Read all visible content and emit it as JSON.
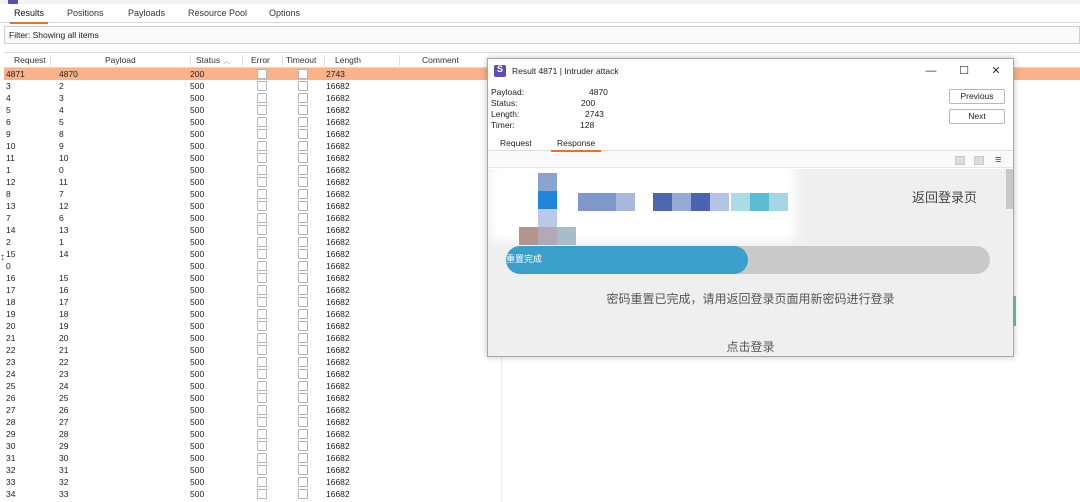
{
  "tabs": [
    {
      "label": "Results",
      "active": true
    },
    {
      "label": "Positions",
      "active": false
    },
    {
      "label": "Payloads",
      "active": false
    },
    {
      "label": "Resource Pool",
      "active": false
    },
    {
      "label": "Options",
      "active": false
    }
  ],
  "filter": {
    "text": "Filter: Showing all items"
  },
  "table": {
    "columns": [
      "Request",
      "Payload",
      "Status",
      "Error",
      "Timeout",
      "Length",
      "Comment"
    ],
    "sorted_column": "Status",
    "rows": [
      {
        "request": "4871",
        "payload": "4870",
        "status": "200",
        "length": "2743",
        "selected": true
      },
      {
        "request": "3",
        "payload": "2",
        "status": "500",
        "length": "16682"
      },
      {
        "request": "4",
        "payload": "3",
        "status": "500",
        "length": "16682"
      },
      {
        "request": "5",
        "payload": "4",
        "status": "500",
        "length": "16682"
      },
      {
        "request": "6",
        "payload": "5",
        "status": "500",
        "length": "16682"
      },
      {
        "request": "9",
        "payload": "8",
        "status": "500",
        "length": "16682"
      },
      {
        "request": "10",
        "payload": "9",
        "status": "500",
        "length": "16682"
      },
      {
        "request": "11",
        "payload": "10",
        "status": "500",
        "length": "16682"
      },
      {
        "request": "1",
        "payload": "0",
        "status": "500",
        "length": "16682"
      },
      {
        "request": "12",
        "payload": "11",
        "status": "500",
        "length": "16682"
      },
      {
        "request": "8",
        "payload": "7",
        "status": "500",
        "length": "16682"
      },
      {
        "request": "13",
        "payload": "12",
        "status": "500",
        "length": "16682"
      },
      {
        "request": "7",
        "payload": "6",
        "status": "500",
        "length": "16682"
      },
      {
        "request": "14",
        "payload": "13",
        "status": "500",
        "length": "16682"
      },
      {
        "request": "2",
        "payload": "1",
        "status": "500",
        "length": "16682"
      },
      {
        "request": "15",
        "payload": "14",
        "status": "500",
        "length": "16682"
      },
      {
        "request": "0",
        "payload": "",
        "status": "500",
        "length": "16682"
      },
      {
        "request": "16",
        "payload": "15",
        "status": "500",
        "length": "16682"
      },
      {
        "request": "17",
        "payload": "16",
        "status": "500",
        "length": "16682"
      },
      {
        "request": "18",
        "payload": "17",
        "status": "500",
        "length": "16682"
      },
      {
        "request": "19",
        "payload": "18",
        "status": "500",
        "length": "16682"
      },
      {
        "request": "20",
        "payload": "19",
        "status": "500",
        "length": "16682"
      },
      {
        "request": "21",
        "payload": "20",
        "status": "500",
        "length": "16682"
      },
      {
        "request": "22",
        "payload": "21",
        "status": "500",
        "length": "16682"
      },
      {
        "request": "23",
        "payload": "22",
        "status": "500",
        "length": "16682"
      },
      {
        "request": "24",
        "payload": "23",
        "status": "500",
        "length": "16682"
      },
      {
        "request": "25",
        "payload": "24",
        "status": "500",
        "length": "16682"
      },
      {
        "request": "26",
        "payload": "25",
        "status": "500",
        "length": "16682"
      },
      {
        "request": "27",
        "payload": "26",
        "status": "500",
        "length": "16682"
      },
      {
        "request": "28",
        "payload": "27",
        "status": "500",
        "length": "16682"
      },
      {
        "request": "29",
        "payload": "28",
        "status": "500",
        "length": "16682"
      },
      {
        "request": "30",
        "payload": "29",
        "status": "500",
        "length": "16682"
      },
      {
        "request": "31",
        "payload": "30",
        "status": "500",
        "length": "16682"
      },
      {
        "request": "32",
        "payload": "31",
        "status": "500",
        "length": "16682"
      },
      {
        "request": "33",
        "payload": "32",
        "status": "500",
        "length": "16682"
      },
      {
        "request": "34",
        "payload": "33",
        "status": "500",
        "length": "16682"
      }
    ]
  },
  "dialog": {
    "title": "Result 4871 | Intruder attack",
    "window_controls": {
      "minimize": "—",
      "maximize": "☐",
      "close": "✕"
    },
    "info": [
      {
        "label": "Payload:",
        "value": "4870"
      },
      {
        "label": "Status:",
        "value": "200"
      },
      {
        "label": "Length:",
        "value": "2743"
      },
      {
        "label": "Timer:",
        "value": "128"
      }
    ],
    "buttons": {
      "previous": "Previous",
      "next": "Next"
    },
    "tabs": [
      {
        "label": "Request",
        "active": false
      },
      {
        "label": "Response",
        "active": true
      }
    ],
    "render": {
      "back_link": "返回登录页",
      "progress_label": "重置完成",
      "progress_value": 0.5,
      "message": "密码重置已完成，请用返回登录页面用新密码进行登录",
      "login_link": "点击登录"
    }
  },
  "colors": {
    "accent": "#e8702a",
    "selected_row": "#f9b28a",
    "progress": "#3aa0cb",
    "burp_logo": "#5b4db3"
  }
}
